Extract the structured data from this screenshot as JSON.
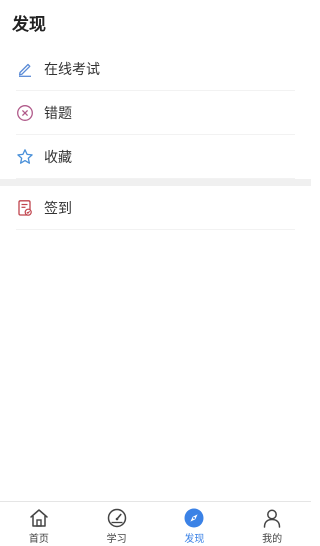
{
  "header": {
    "title": "发现"
  },
  "menu": {
    "group1": [
      {
        "label": "在线考试",
        "icon": "pencil-icon",
        "color": "#5b8bd6"
      },
      {
        "label": "错题",
        "icon": "circle-x-icon",
        "color": "#b05a8a"
      },
      {
        "label": "收藏",
        "icon": "star-outline-icon",
        "color": "#4a90d9"
      }
    ],
    "group2": [
      {
        "label": "签到",
        "icon": "checkin-document-icon",
        "color": "#c0444d"
      }
    ]
  },
  "tabbar": {
    "items": [
      {
        "label": "首页",
        "icon": "home-icon",
        "active": false
      },
      {
        "label": "学习",
        "icon": "speedometer-icon",
        "active": false
      },
      {
        "label": "发现",
        "icon": "compass-icon",
        "active": true
      },
      {
        "label": "我的",
        "icon": "user-icon",
        "active": false
      }
    ],
    "active_color": "#3b82e6",
    "inactive_color": "#444444"
  }
}
